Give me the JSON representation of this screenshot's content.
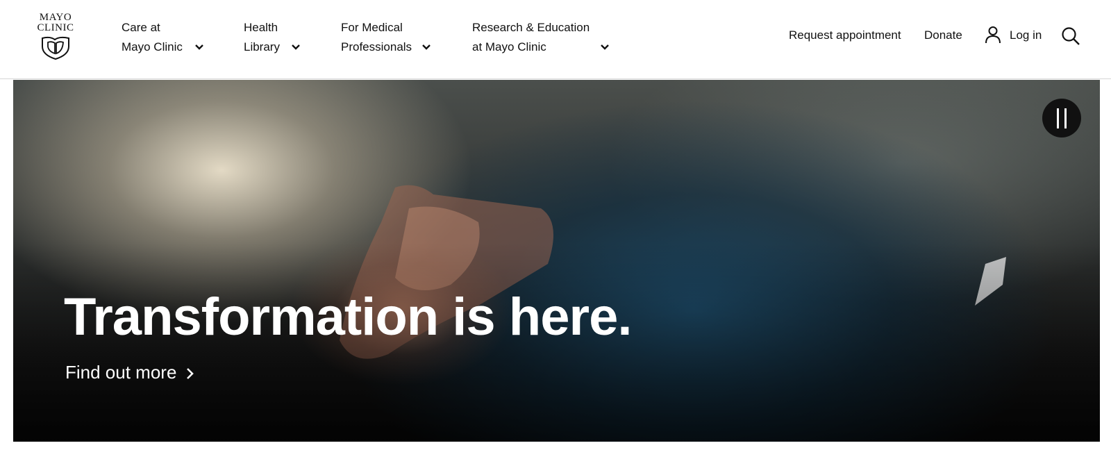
{
  "brand": {
    "logo_line1": "MAYO",
    "logo_line2": "CLINIC"
  },
  "nav": {
    "items": [
      {
        "line1": "Care at",
        "line2": "Mayo Clinic"
      },
      {
        "line1": "Health",
        "line2": "Library"
      },
      {
        "line1": "For Medical",
        "line2": "Professionals"
      },
      {
        "line1": "Research & Education",
        "line2": "at Mayo Clinic"
      }
    ]
  },
  "utility": {
    "request_appointment": "Request appointment",
    "donate": "Donate",
    "login": "Log in"
  },
  "hero": {
    "title": "Transformation is here.",
    "link": "Find out more"
  },
  "icons": {
    "chevron": "chevron-down-icon",
    "user": "user-icon",
    "search": "search-icon",
    "pause": "pause-icon",
    "arrow": "chevron-right-icon"
  },
  "colors": {
    "header_bg": "#ffffff",
    "text": "#111111",
    "hero_text": "#ffffff",
    "pause_bg": "#111111"
  }
}
